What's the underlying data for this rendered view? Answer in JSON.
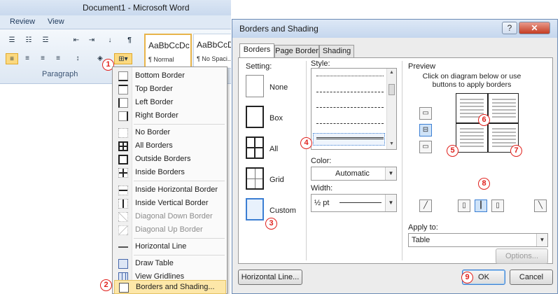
{
  "word": {
    "title": "Document1  -  Microsoft Word",
    "tabs": [
      "Review",
      "View"
    ],
    "group_label": "Paragraph",
    "styles": [
      {
        "preview": "AaBbCcDc",
        "name": "¶ Normal"
      },
      {
        "preview": "AaBbCcDc",
        "name": "¶ No Spaci..."
      }
    ]
  },
  "menu": {
    "items": [
      {
        "label": "Bottom Border",
        "icon": "bottom-border-icon",
        "disabled": false
      },
      {
        "label": "Top Border",
        "icon": "top-border-icon",
        "disabled": false
      },
      {
        "label": "Left Border",
        "icon": "left-border-icon",
        "disabled": false
      },
      {
        "label": "Right Border",
        "icon": "right-border-icon",
        "disabled": false
      },
      {
        "label": "No Border",
        "icon": "no-border-icon",
        "disabled": false
      },
      {
        "label": "All Borders",
        "icon": "all-borders-icon",
        "disabled": false
      },
      {
        "label": "Outside Borders",
        "icon": "outside-borders-icon",
        "disabled": false
      },
      {
        "label": "Inside Borders",
        "icon": "inside-borders-icon",
        "disabled": false
      },
      {
        "label": "Inside Horizontal Border",
        "icon": "inside-horizontal-border-icon",
        "disabled": false
      },
      {
        "label": "Inside Vertical Border",
        "icon": "inside-vertical-border-icon",
        "disabled": false
      },
      {
        "label": "Diagonal Down Border",
        "icon": "diagonal-down-border-icon",
        "disabled": true
      },
      {
        "label": "Diagonal Up Border",
        "icon": "diagonal-up-border-icon",
        "disabled": true
      },
      {
        "label": "Horizontal Line",
        "icon": "horizontal-line-icon",
        "disabled": false
      },
      {
        "label": "Draw Table",
        "icon": "draw-table-icon",
        "disabled": false
      },
      {
        "label": "View Gridlines",
        "icon": "view-gridlines-icon",
        "disabled": false
      },
      {
        "label": "Borders and Shading...",
        "icon": "borders-and-shading-icon",
        "disabled": false
      }
    ]
  },
  "dialog": {
    "title": "Borders and Shading",
    "help": "?",
    "close": "✕",
    "tabs": [
      "Borders",
      "Page Border",
      "Shading"
    ],
    "setting_label": "Setting:",
    "settings": [
      "None",
      "Box",
      "All",
      "Grid",
      "Custom"
    ],
    "style_label": "Style:",
    "color_label": "Color:",
    "color_value": "Automatic",
    "width_label": "Width:",
    "width_value": "½ pt",
    "preview_label": "Preview",
    "preview_hint": "Click on diagram below or use buttons to apply borders",
    "apply_label": "Apply to:",
    "apply_value": "Table",
    "options_button": "Options...",
    "horizontal_line_button": "Horizontal Line...",
    "ok_button": "OK",
    "cancel_button": "Cancel"
  },
  "callouts": [
    "1",
    "2",
    "3",
    "4",
    "5",
    "6",
    "7",
    "8",
    "9"
  ],
  "colors": {
    "callout": "#e0201c",
    "highlight": "#fde7a8",
    "accent": "#3c7fd3"
  }
}
